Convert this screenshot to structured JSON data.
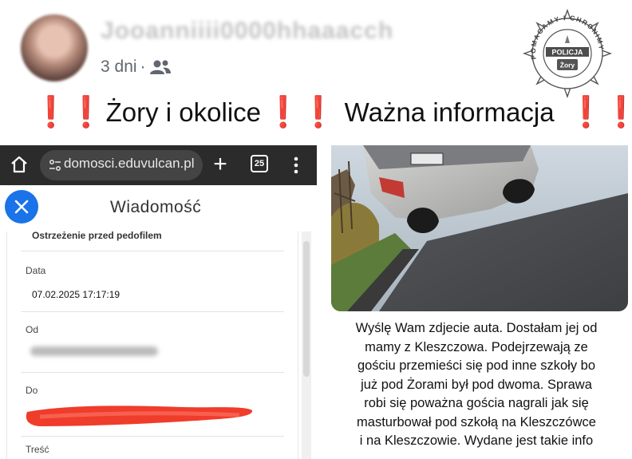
{
  "post": {
    "author_name": "Jooanniiii0000hhaaacch",
    "time": "3 dni",
    "separator": "·",
    "audience_icon": "friends-icon",
    "headline": {
      "marks_left": "❗❗",
      "text_part1": "Żory i okolice",
      "marks_mid": "❗❗",
      "text_part2": "Ważna informacja",
      "marks_right": "❗❗"
    },
    "badge": {
      "arc_text": "POMAGAMY I CHRONIMY",
      "band_text": "POLICJA",
      "city": "Żory"
    }
  },
  "left_screenshot": {
    "browser": {
      "url": "domosci.eduvulcan.pl",
      "tab_count": "25"
    },
    "message": {
      "title": "Wiadomość",
      "subject": "Ostrzeżenie przed pedofilem",
      "fields": [
        {
          "label": "Data",
          "value": "07.02.2025 17:17:19"
        },
        {
          "label": "Od",
          "value": ""
        },
        {
          "label": "Do",
          "value": ""
        },
        {
          "label": "Treść",
          "value": ""
        }
      ]
    }
  },
  "right_screenshot": {
    "caption_lines": [
      "Wyślę Wam zdjecie auta. Dostałam jej od",
      "mamy z Kleszczowa. Podejrzewają ze",
      "gościu przemieści się pod inne szkoły bo",
      "już pod Żorami był pod dwoma. Sprawa",
      "robi się poważna gościa nagrali jak się",
      "masturbował pod szkołą na Kleszczówce",
      "i na Kleszczowie. Wydane jest takie info"
    ]
  },
  "colors": {
    "alert_red": "#e3202a",
    "browser_dark": "#2b2b2b",
    "close_blue": "#1a73e8",
    "redaction_red": "#f03c2b"
  }
}
